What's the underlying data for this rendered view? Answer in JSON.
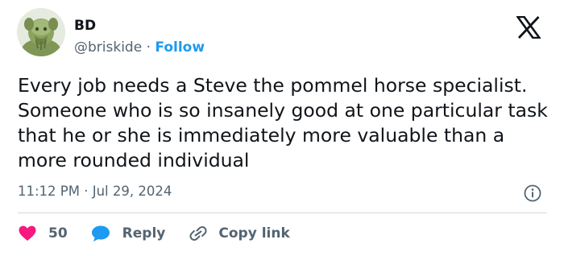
{
  "author": {
    "name": "BD",
    "handle": "@briskide",
    "separator": "·",
    "follow_label": "Follow"
  },
  "tweet": {
    "text": "Every job needs a Steve the pommel horse specialist. Someone who is so insanely good at one particular task that he or she is immediately more valuable than a more rounded individual",
    "time": "11:12 PM",
    "date": "Jul 29, 2024",
    "meta_separator": "·"
  },
  "actions": {
    "likes": "50",
    "reply_label": "Reply",
    "copy_link_label": "Copy link"
  },
  "icons": {
    "brand": "x-logo-icon",
    "info": "info-icon",
    "like": "heart-icon",
    "reply": "speech-bubble-icon",
    "copy": "link-icon"
  },
  "colors": {
    "text": "#0f1419",
    "secondary": "#536471",
    "accent": "#1d9bf0",
    "like": "#f91880",
    "divider": "#cfd9de"
  }
}
